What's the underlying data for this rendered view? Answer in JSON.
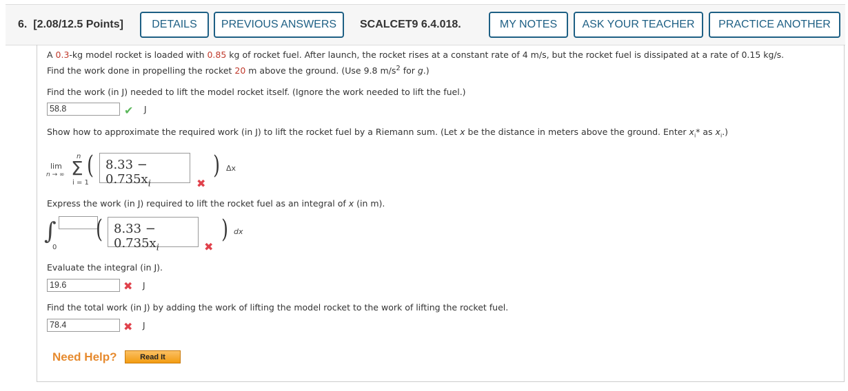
{
  "header": {
    "question_number": "6.",
    "points": "[2.08/12.5 Points]",
    "buttons": {
      "details": "DETAILS",
      "previous_answers": "PREVIOUS ANSWERS",
      "my_notes": "MY NOTES",
      "ask_teacher": "ASK YOUR TEACHER",
      "practice_another": "PRACTICE ANOTHER"
    },
    "problem_code": "SCALCET9 6.4.018."
  },
  "problem": {
    "line1_a": "A ",
    "rocket_mass": "0.3",
    "line1_b": "-kg model rocket is loaded with ",
    "fuel_mass": "0.85",
    "line1_c": " kg of rocket fuel. After launch, the rocket rises at a constant rate of 4 m/s, but the rocket fuel is dissipated at a rate of 0.15 kg/s.",
    "line2_a": "Find the work done in propelling the rocket ",
    "height": "20",
    "line2_b": " m above the ground. (Use 9.8 m/s",
    "line2_sup": "2",
    "line2_c": " for ",
    "line2_g": "g",
    "line2_d": ".)"
  },
  "parts": {
    "p1": {
      "prompt": "Find the work (in J) needed to lift the model rocket itself. (Ignore the work needed to lift the fuel.)",
      "value": "58.8",
      "unit": "J",
      "status": "correct"
    },
    "p2": {
      "prompt_a": "Show how to approximate the required work (in J) to lift the rocket fuel by a Riemann sum. (Let ",
      "prompt_x": "x",
      "prompt_b": " be the distance in meters above the ground. Enter ",
      "prompt_xi": "x",
      "prompt_i1": "i",
      "prompt_star": "*",
      "prompt_c": " as ",
      "prompt_xi2": "x",
      "prompt_i2": "i",
      "prompt_d": ".)",
      "lim": "lim",
      "lim_sub": "n → ∞",
      "sum_top": "n",
      "sum_bottom": "i = 1",
      "sigma": "Σ",
      "value_main": "8.33 − 0.735x",
      "value_sub": "i",
      "suffix": "Δx",
      "status": "incorrect"
    },
    "p3": {
      "prompt_a": "Express the work (in J) required to lift the rocket fuel as an integral of ",
      "prompt_x": "x",
      "prompt_b": " (in m).",
      "integral": "∫",
      "lower": "0",
      "upper_value": "",
      "value_main": "8.33 − 0.735x",
      "value_sub": "i",
      "suffix": "dx",
      "status": "incorrect"
    },
    "p4": {
      "prompt": "Evaluate the integral (in J).",
      "value": "19.6",
      "unit": "J",
      "status": "incorrect"
    },
    "p5": {
      "prompt": "Find the total work (in J) by adding the work of lifting the model rocket to the work of lifting the rocket fuel.",
      "value": "78.4",
      "unit": "J",
      "status": "incorrect"
    }
  },
  "help": {
    "label": "Need Help?",
    "read_it": "Read It"
  },
  "icons": {
    "check": "✔",
    "cross": "✖"
  },
  "colors": {
    "accent": "#1d5f84",
    "highlight_red": "#c0392b",
    "correct_green": "#5cb85c",
    "incorrect_red": "#e0414b",
    "help_orange": "#e68a2e"
  }
}
